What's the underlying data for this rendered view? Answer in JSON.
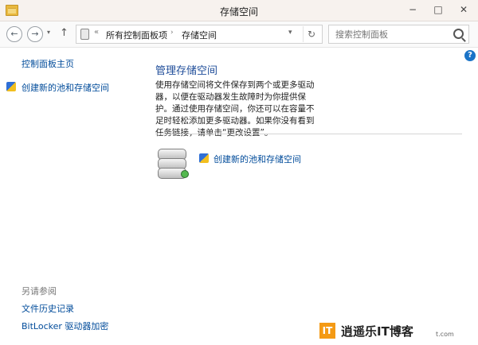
{
  "window": {
    "title": "存储空间",
    "minimize": "−",
    "maximize": "□",
    "close": "✕"
  },
  "toolbar": {
    "back_label": "←",
    "forward_label": "→",
    "dropdown_label": "▾",
    "up_label": "↑",
    "address": {
      "separator": "«",
      "items": [
        "所有控制面板项",
        "存储空间"
      ],
      "arrow": "›",
      "dropdown": "▾",
      "refresh": "↻"
    },
    "search_placeholder": "搜索控制面板"
  },
  "help_label": "?",
  "sidebar": {
    "home": "控制面板主页",
    "create_pool": "创建新的池和存储空间",
    "see_also": "另请参阅",
    "file_history": "文件历史记录",
    "bitlocker": "BitLocker 驱动器加密"
  },
  "main": {
    "title": "管理存储空间",
    "description": "使用存储空间将文件保存到两个或更多驱动器，以便在驱动器发生故障时为你提供保护。通过使用存储空间，你还可以在容量不足时轻松添加更多驱动器。如果你没有看到任务链接，请单击“更改设置”。",
    "create_pool_link": "创建新的池和存储空间"
  },
  "watermark": {
    "logo": "IT",
    "text": "逍遥乐IT博客",
    "small": "t.com"
  },
  "colors": {
    "link": "#004b9a",
    "title": "#1e4c99",
    "accent_help": "#1a73c7"
  }
}
